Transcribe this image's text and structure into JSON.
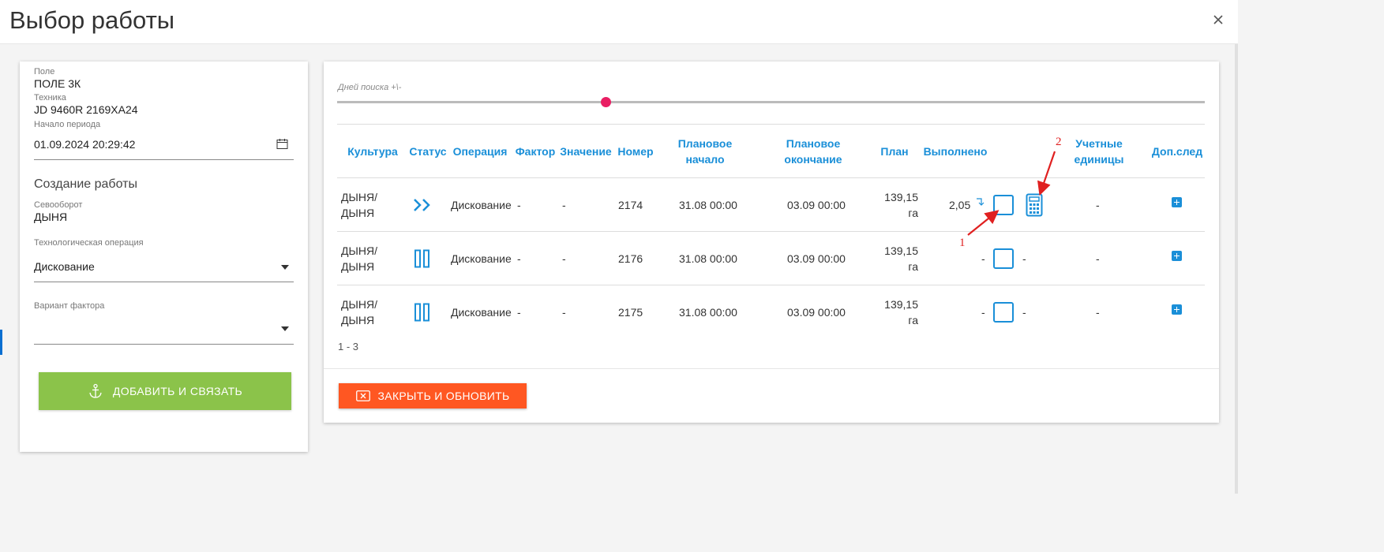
{
  "modal": {
    "title": "Выбор работы"
  },
  "left_panel": {
    "field_label": "Поле",
    "field_value": "ПОЛЕ 3К",
    "machine_label": "Техника",
    "machine_value": "JD 9460R 2169ХА24",
    "period_start_label": "Начало периода",
    "period_start_value": "01.09.2024 20:29:42",
    "section_title": "Создание работы",
    "crop_rotation_label": "Севооборот",
    "crop_rotation_value": "ДЫНЯ",
    "tech_operation_label": "Технологическая операция",
    "tech_operation_value": "Дискование",
    "factor_variant_label": "Вариант фактора",
    "factor_variant_value": "",
    "add_button_label": "ДОБАВИТЬ И СВЯЗАТЬ"
  },
  "right_panel": {
    "slider_label": "Дней поиска +\\-",
    "slider_value_fraction": 0.31,
    "columns": {
      "crop": "Культура",
      "status": "Статус",
      "operation": "Операция",
      "factor": "Фактор",
      "value": "Значение",
      "number": "Номер",
      "planned_start_1": "Плановое",
      "planned_start_2": "начало",
      "planned_end_1": "Плановое",
      "planned_end_2": "окончание",
      "plan": "План",
      "done": "Выполнено",
      "units_1": "Учетные",
      "units_2": "единицы",
      "extra": "Доп.след"
    },
    "rows": [
      {
        "crop_1": "ДЫНЯ/",
        "crop_2": "ДЫНЯ",
        "status_icon": "forward-icon",
        "operation": "Дискование",
        "factor": "-",
        "value": "-",
        "number": "2174",
        "planned_start": "31.08 00:00",
        "planned_end": "03.09 00:00",
        "plan_1": "139,15",
        "plan_2": "га",
        "done": "2,05",
        "units": "-"
      },
      {
        "crop_1": "ДЫНЯ/",
        "crop_2": "ДЫНЯ",
        "status_icon": "pause-icon",
        "operation": "Дискование",
        "factor": "-",
        "value": "-",
        "number": "2176",
        "planned_start": "31.08 00:00",
        "planned_end": "03.09 00:00",
        "plan_1": "139,15",
        "plan_2": "га",
        "done": "-",
        "done_after": "-",
        "units": "-"
      },
      {
        "crop_1": "ДЫНЯ/",
        "crop_2": "ДЫНЯ",
        "status_icon": "pause-icon",
        "operation": "Дискование",
        "factor": "-",
        "value": "-",
        "number": "2175",
        "planned_start": "31.08 00:00",
        "planned_end": "03.09 00:00",
        "plan_1": "139,15",
        "plan_2": "га",
        "done": "-",
        "done_after": "-",
        "units": "-"
      }
    ],
    "pager": "1 - 3",
    "close_button_label": "ЗАКРЫТЬ И ОБНОВИТЬ"
  },
  "annotations": {
    "label_1": "1",
    "label_2": "2"
  },
  "colors": {
    "accent_blue": "#1a8fd8",
    "green_button": "#8bc34a",
    "orange_button": "#ff5722",
    "slider_thumb": "#e91e63",
    "annotation_red": "#e02020"
  }
}
